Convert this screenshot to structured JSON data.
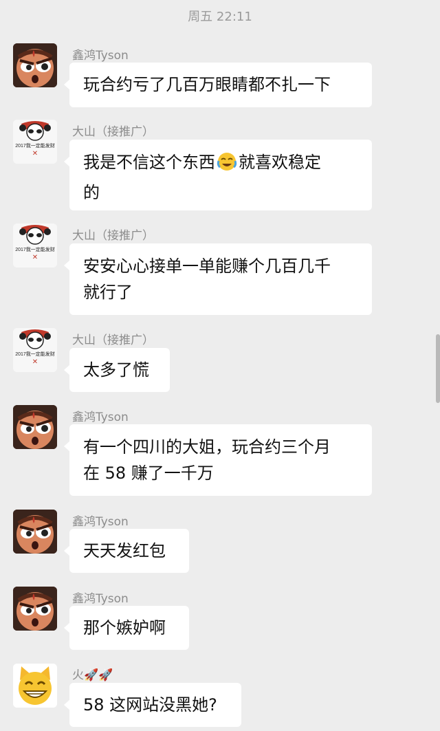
{
  "timestamp": "周五 22:11",
  "messages": [
    {
      "sender": "鑫鸿Tyson",
      "avatar": "angry-cartoon-face-icon",
      "lines": [
        "玩合约亏了几百万眼睛都不扎一下"
      ]
    },
    {
      "sender": "大山（接推广）",
      "avatar": "panda-meme-icon",
      "lines": [
        "我是不信这个东西",
        "就喜欢稳定",
        "的"
      ],
      "emoji": "crying-laughing-emoji"
    },
    {
      "sender": "大山（接推广）",
      "avatar": "panda-meme-icon",
      "lines": [
        "安安心心接单一单能赚个几百几千",
        "就行了"
      ]
    },
    {
      "sender": "大山（接推广）",
      "avatar": "panda-meme-icon",
      "lines": [
        "太多了慌"
      ]
    },
    {
      "sender": "鑫鸿Tyson",
      "avatar": "angry-cartoon-face-icon",
      "lines": [
        "有一个四川的大姐，玩合约三个月",
        "在 58 赚了一千万"
      ]
    },
    {
      "sender": "鑫鸿Tyson",
      "avatar": "angry-cartoon-face-icon",
      "lines": [
        "天天发红包"
      ]
    },
    {
      "sender": "鑫鸿Tyson",
      "avatar": "angry-cartoon-face-icon",
      "lines": [
        "那个嫉妒啊"
      ]
    },
    {
      "sender": "火",
      "avatar": "grinning-cat-icon",
      "lines": [
        "58 这网站没黑她?"
      ],
      "sender_emoji": "rocket-emoji"
    }
  ],
  "panda_caption": "2017我一定能发财"
}
